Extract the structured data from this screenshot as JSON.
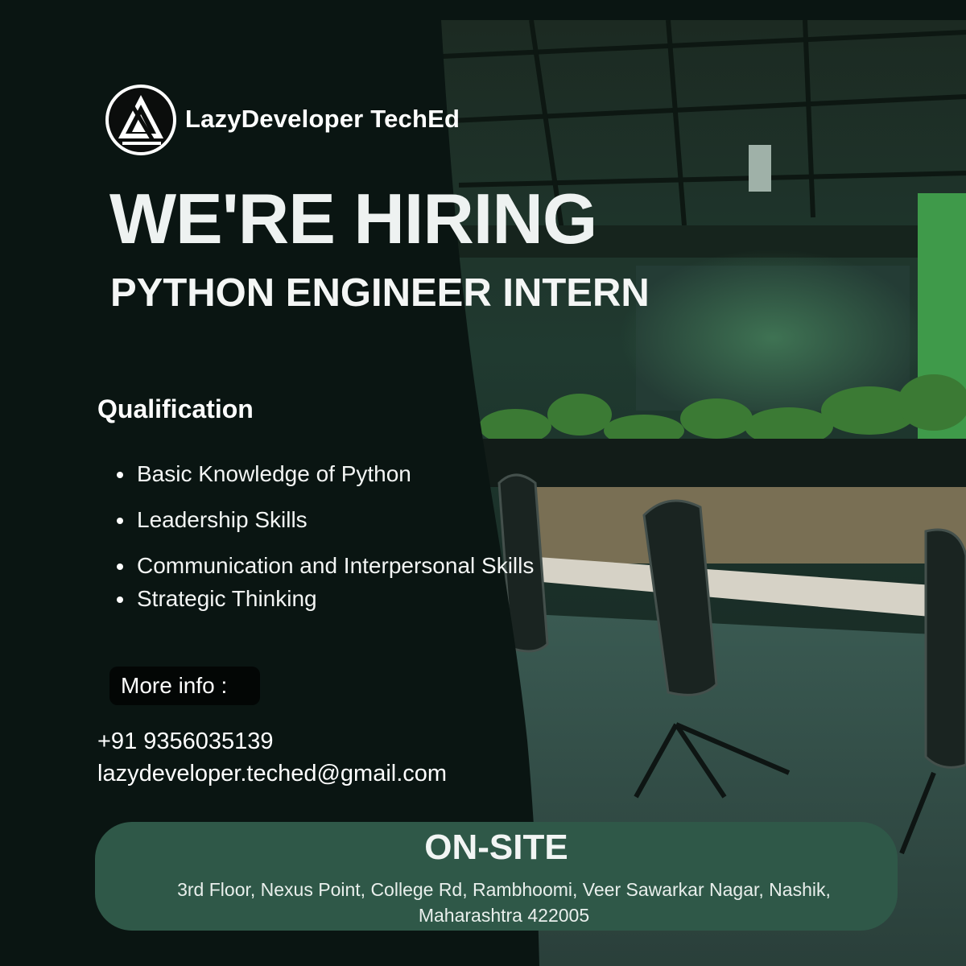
{
  "colors": {
    "background": "#0a1512",
    "accent_green": "#2f5848",
    "text": "#ffffff"
  },
  "brand": {
    "name": "LazyDeveloper TechEd",
    "logo_icon": "triangle-monogram-logo"
  },
  "headline": "WE'RE HIRING",
  "role": "PYTHON ENGINEER INTERN",
  "qualification": {
    "title": "Qualification",
    "items": [
      "Basic Knowledge of Python",
      "Leadership Skills",
      "Communication and Interpersonal Skills",
      "Strategic Thinking"
    ]
  },
  "contact": {
    "more_info_label": "More info :",
    "phone": "+91 9356035139",
    "email": "lazydeveloper.teched@gmail.com"
  },
  "location": {
    "title": "ON-SITE",
    "address": "3rd Floor, Nexus Point, College Rd, Rambhoomi, Veer Sawarkar Nagar, Nashik, Maharashtra 422005"
  }
}
